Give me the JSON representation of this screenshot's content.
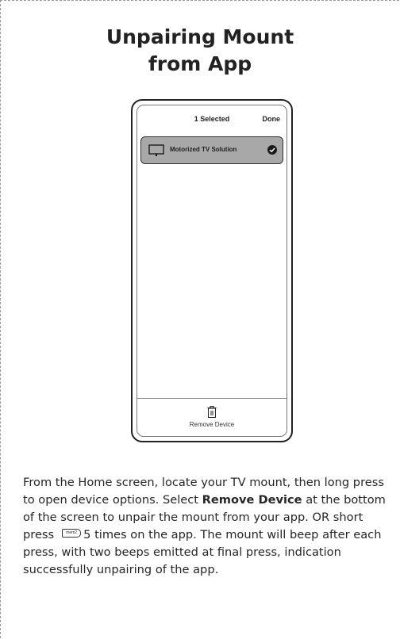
{
  "title_line1": "Unpairing Mount",
  "title_line2": "from App",
  "phone": {
    "selected_label": "1 Selected",
    "done_label": "Done",
    "device_name": "Motorized TV Solution",
    "remove_label": "Remove Device"
  },
  "body": {
    "part1": "From the Home screen, locate your TV mount, then long press to open device options. Select ",
    "bold": "Remove Device",
    "part2": " at the bottom of the screen to unpair the mount from your app.  OR short press",
    "mem_label": "mem2",
    "part3": "5 times on the app. The mount will beep after each press, with two beeps emitted at final press, indication successfully unpairing of the app."
  }
}
